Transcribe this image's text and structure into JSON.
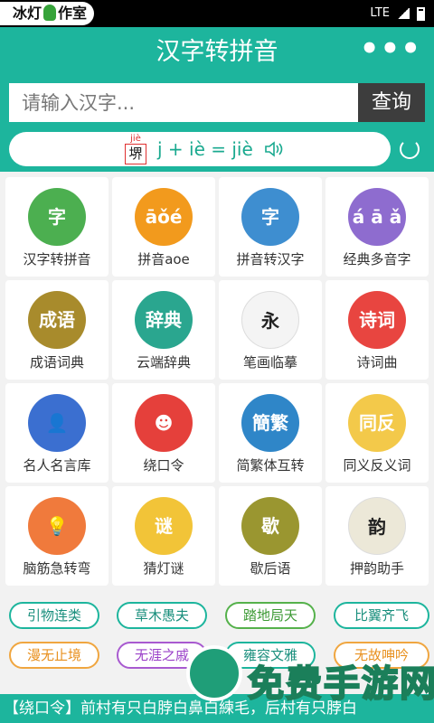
{
  "statusbar": {
    "watermark_pre": "冰灯",
    "watermark_post": "作室",
    "network": "LTE"
  },
  "header": {
    "title": "汉字转拼音",
    "search_placeholder": "请输入汉字...",
    "search_button": "查询",
    "demo_char": "堺",
    "demo_pinyin": "jiè",
    "demo_formula": "j + iè = jiè"
  },
  "grid": [
    {
      "label": "汉字转拼音",
      "icon_text": "字",
      "color": "#4caf50"
    },
    {
      "label": "拼音aoe",
      "icon_text": "āǒé",
      "color": "#f29a1d"
    },
    {
      "label": "拼音转汉字",
      "icon_text": "字",
      "color": "#3e8ed0"
    },
    {
      "label": "经典多音字",
      "icon_text": "á ā ǎ",
      "color": "#8e6ccf"
    },
    {
      "label": "成语词典",
      "icon_text": "成语",
      "color": "#a88b2c"
    },
    {
      "label": "云端辞典",
      "icon_text": "辞典",
      "color": "#2aa68f"
    },
    {
      "label": "笔画临摹",
      "icon_text": "永",
      "color": "#f4f4f4"
    },
    {
      "label": "诗词曲",
      "icon_text": "诗词",
      "color": "#e84540"
    },
    {
      "label": "名人名言库",
      "icon_text": "👤",
      "color": "#3b6fd0"
    },
    {
      "label": "绕口令",
      "icon_text": "☻",
      "color": "#e5403b"
    },
    {
      "label": "简繁体互转",
      "icon_text": "簡繁",
      "color": "#2f86c8"
    },
    {
      "label": "同义反义词",
      "icon_text": "同反",
      "color": "#f3c94a"
    },
    {
      "label": "脑筋急转弯",
      "icon_text": "💡",
      "color": "#f07a3c"
    },
    {
      "label": "猜灯谜",
      "icon_text": "谜",
      "color": "#f2c438"
    },
    {
      "label": "歇后语",
      "icon_text": "歇",
      "color": "#9a9630"
    },
    {
      "label": "押韵助手",
      "icon_text": "韵",
      "color": "#ece8d8"
    }
  ],
  "tags": [
    {
      "label": "引物连类",
      "style": "teal"
    },
    {
      "label": "草木愚夫",
      "style": "teal"
    },
    {
      "label": "踏地局天",
      "style": "green"
    },
    {
      "label": "比翼齐飞",
      "style": "teal"
    },
    {
      "label": "漫无止境",
      "style": "orange"
    },
    {
      "label": "无涯之戚",
      "style": "purple"
    },
    {
      "label": "雍容文雅",
      "style": "teal"
    },
    {
      "label": "无故呻吟",
      "style": "orange"
    }
  ],
  "ticker": "【绕口令】前村有只白脖白鼻白練毛，后村有只脖白",
  "overlay_watermark": "免费手游网"
}
